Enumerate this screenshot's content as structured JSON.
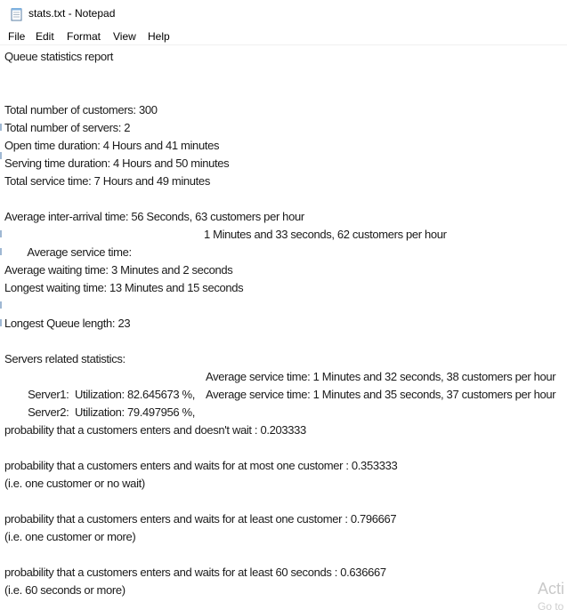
{
  "window": {
    "title": "stats.txt - Notepad"
  },
  "menu": {
    "items": [
      "File",
      "Edit",
      "Format",
      "View",
      "Help"
    ]
  },
  "content": {
    "line_01": "Queue statistics report",
    "line_02": "Total number of customers: 300",
    "line_03": "Total number of servers: 2",
    "line_04": "Open time duration: 4 Hours and 41 minutes",
    "line_05": "Serving time duration: 4 Hours and 50 minutes",
    "line_06": "Total service time: 7 Hours and 49 minutes",
    "line_07": "Average inter-arrival time: 56 Seconds, 63 customers per hour",
    "line_08a": "Average service time:",
    "line_08b": "1 Minutes and 33 seconds, 62 customers per hour",
    "line_09": "Average waiting time: 3 Minutes and 2 seconds",
    "line_10": "Longest waiting time: 13 Minutes and 15 seconds",
    "line_11": "Longest Queue length: 23",
    "line_12": "Servers related statistics:",
    "line_13a": "Server1:  Utilization: 82.645673 %,",
    "line_13b": "Average service time: 1 Minutes and 32 seconds, 38 customers per hour",
    "line_14a": "Server2:  Utilization: 79.497956 %,",
    "line_14b": "Average service time: 1 Minutes and 35 seconds, 37 customers per hour",
    "line_15": "probability that a customers enters and doesn't wait : 0.203333",
    "line_16": "probability that a customers enters and waits for at most one customer : 0.353333",
    "line_17": "(i.e. one customer or no wait)",
    "line_18": "probability that a customers enters and waits for at least one customer : 0.796667",
    "line_19": "(i.e. one customer or more)",
    "line_20": "probability that a customers enters and waits for at least 60 seconds : 0.636667",
    "line_21": "(i.e. 60 seconds or more)"
  },
  "watermark": {
    "line1": "Acti",
    "line2": "Go to"
  }
}
